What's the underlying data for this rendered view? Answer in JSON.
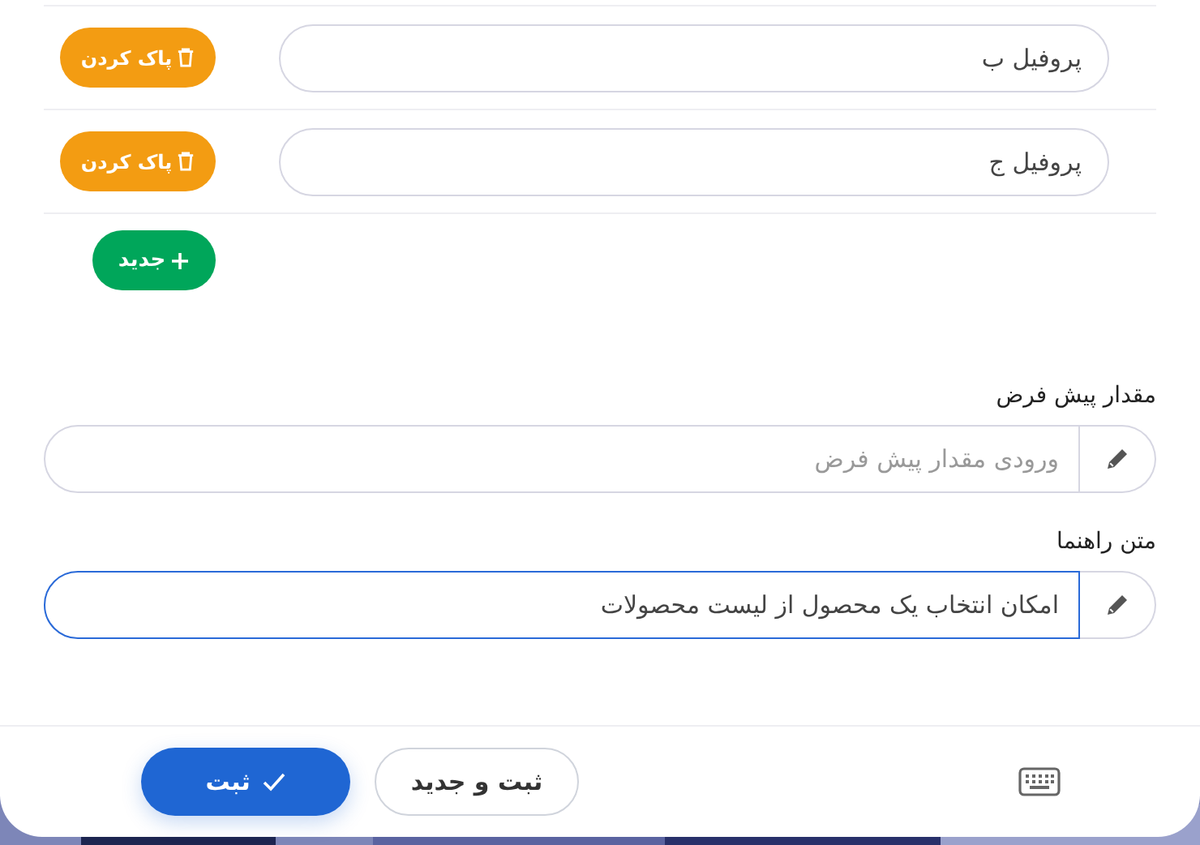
{
  "profiles": [
    {
      "value": "پروفیل ب",
      "action": "پاک کردن"
    },
    {
      "value": "پروفیل ج",
      "action": "پاک کردن"
    }
  ],
  "add_button": "جدید",
  "fields": [
    {
      "label": "مقدار پیش فرض",
      "placeholder": "ورودی مقدار پیش فرض",
      "focused": false
    },
    {
      "label": "متن راهنما",
      "value": "امکان انتخاب یک محصول از لیست محصولات",
      "focused": true
    }
  ],
  "footer": {
    "buttons": [
      {
        "label": "ثبت و جدید",
        "kind": "secondary"
      },
      {
        "label": "ثبت",
        "kind": "primary"
      }
    ]
  }
}
